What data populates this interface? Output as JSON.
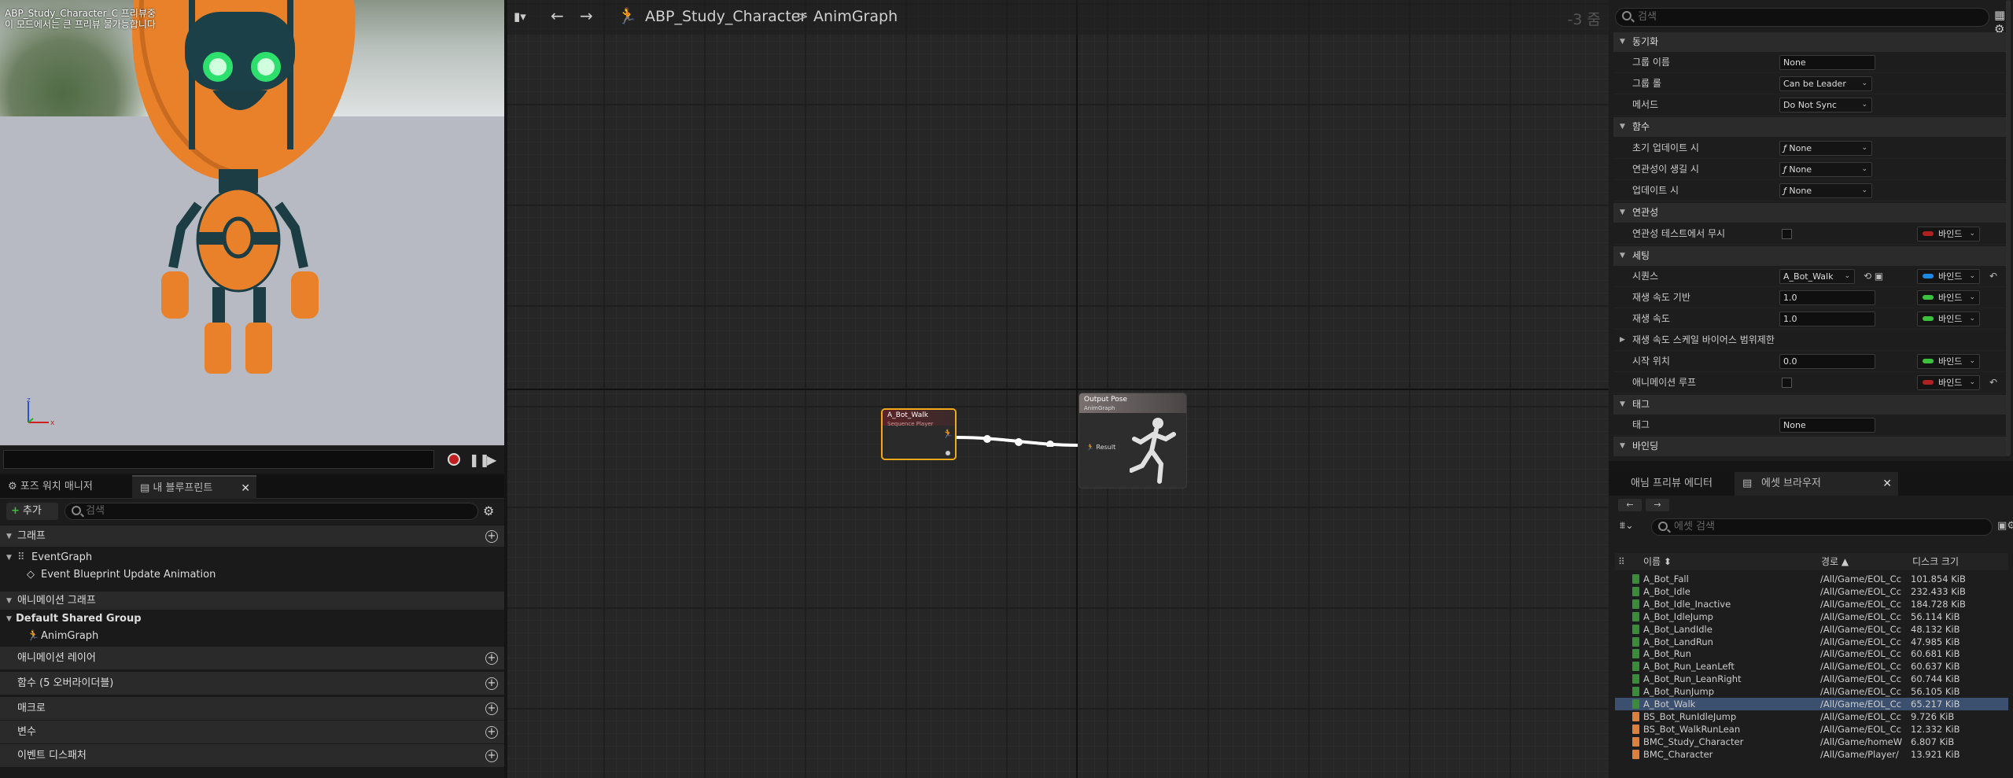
{
  "viewport": {
    "title_line1": "ABP_Study_Character_C 프리뷰중",
    "title_line2": "이 모드에서는 큰 프리뷰 불가능합니다",
    "axis_z": "z",
    "axis_x": "x"
  },
  "leftpanel": {
    "tab1": "포즈 워치 매니저",
    "tab2": "내 블루프린트",
    "add_label": "추가",
    "search_placeholder": "검색",
    "section_graph": "그래프",
    "event_graph": "EventGraph",
    "event_update": "Event Blueprint Update Animation",
    "section_anim_graph": "애니메이션 그래프",
    "default_shared_group": "Default Shared Group",
    "anim_graph_item": "AnimGraph",
    "section_anim_layer": "애니메이션 레이어",
    "section_functions": "함수 (5 오버라이더블)",
    "section_macros": "매크로",
    "section_variables": "변수",
    "section_dispatchers": "이벤트 디스패처"
  },
  "graph": {
    "breadcrumb_blueprint": "ABP_Study_Character",
    "breadcrumb_separator": ">",
    "breadcrumb_graph": "AnimGraph",
    "zoom_label": "-3 줌",
    "node_player_title": "A_Bot_Walk",
    "node_player_subtitle": "Sequence Player",
    "node_output_title": "Output Pose",
    "node_output_subtitle": "AnimGraph",
    "node_output_pin": "Result"
  },
  "details": {
    "search_placeholder": "검색",
    "sec_sync": "동기화",
    "group_name_label": "그룹 이름",
    "group_name_value": "None",
    "group_role_label": "그룹 롤",
    "group_role_value": "Can be Leader",
    "method_label": "메서드",
    "method_value": "Do Not Sync",
    "sec_functions": "함수",
    "initial_update_label": "초기 업데이트 시",
    "relevancy_label": "연관성이 생길 시",
    "update_label": "업데이트 시",
    "func_none": "None",
    "sec_relevancy": "연관성",
    "ignore_relevancy_label": "연관성 테스트에서 무시",
    "bind_label": "바인드",
    "sec_settings": "세팅",
    "sequence_label": "시퀀스",
    "sequence_value": "A_Bot_Walk",
    "play_rate_basis_label": "재생 속도 기반",
    "play_rate_basis_value": "1.0",
    "play_rate_label": "재생 속도",
    "play_rate_value": "1.0",
    "play_rate_scale_label": "재생 속도 스케일 바이어스 범위제한",
    "start_position_label": "시작 위치",
    "start_position_value": "0.0",
    "loop_label": "애니메이션 루프",
    "sec_tag": "태그",
    "tag_label": "태그",
    "tag_value": "None",
    "sec_binding": "바인딩"
  },
  "content_browser": {
    "tab1": "애님 프리뷰 에디터",
    "tab2": "에셋 브라우저",
    "search_placeholder": "에셋 검색",
    "col_name": "이름",
    "col_path": "경로",
    "col_size": "디스크 크기",
    "assets": [
      {
        "name": "A_Bot_Fall",
        "path": "/All/Game/EOL_Cc",
        "size": "101.854 KiB",
        "color": "#3c8a3c"
      },
      {
        "name": "A_Bot_Idle",
        "path": "/All/Game/EOL_Cc",
        "size": "232.433 KiB",
        "color": "#3c8a3c"
      },
      {
        "name": "A_Bot_Idle_Inactive",
        "path": "/All/Game/EOL_Cc",
        "size": "184.728 KiB",
        "color": "#3c8a3c"
      },
      {
        "name": "A_Bot_IdleJump",
        "path": "/All/Game/EOL_Cc",
        "size": "56.114 KiB",
        "color": "#3c8a3c"
      },
      {
        "name": "A_Bot_LandIdle",
        "path": "/All/Game/EOL_Cc",
        "size": "48.132 KiB",
        "color": "#3c8a3c"
      },
      {
        "name": "A_Bot_LandRun",
        "path": "/All/Game/EOL_Cc",
        "size": "47.985 KiB",
        "color": "#3c8a3c"
      },
      {
        "name": "A_Bot_Run",
        "path": "/All/Game/EOL_Cc",
        "size": "60.681 KiB",
        "color": "#3c8a3c"
      },
      {
        "name": "A_Bot_Run_LeanLeft",
        "path": "/All/Game/EOL_Cc",
        "size": "60.637 KiB",
        "color": "#3c8a3c"
      },
      {
        "name": "A_Bot_Run_LeanRight",
        "path": "/All/Game/EOL_Cc",
        "size": "60.744 KiB",
        "color": "#3c8a3c"
      },
      {
        "name": "A_Bot_RunJump",
        "path": "/All/Game/EOL_Cc",
        "size": "56.105 KiB",
        "color": "#3c8a3c"
      },
      {
        "name": "A_Bot_Walk",
        "path": "/All/Game/EOL_Cc",
        "size": "65.217 KiB",
        "color": "#3c8a3c",
        "selected": true
      },
      {
        "name": "BS_Bot_RunIdleJump",
        "path": "/All/Game/EOL_Cc",
        "size": "9.726 KiB",
        "color": "#d8803c"
      },
      {
        "name": "BS_Bot_WalkRunLean",
        "path": "/All/Game/EOL_Cc",
        "size": "12.332 KiB",
        "color": "#d8803c"
      },
      {
        "name": "BMC_Study_Character",
        "path": "/All/Game/homeW",
        "size": "6.807 KiB",
        "color": "#d8803c"
      },
      {
        "name": "BMC_Character",
        "path": "/All/Game/Player/",
        "size": "13.921 KiB",
        "color": "#d8803c"
      }
    ]
  },
  "colors": {
    "accent_node": "#f3a81a",
    "selected_row": "#3b4f6e",
    "bind_red": "#b02020",
    "bind_green": "#3cc13c",
    "bind_blue": "#1e88e5"
  }
}
